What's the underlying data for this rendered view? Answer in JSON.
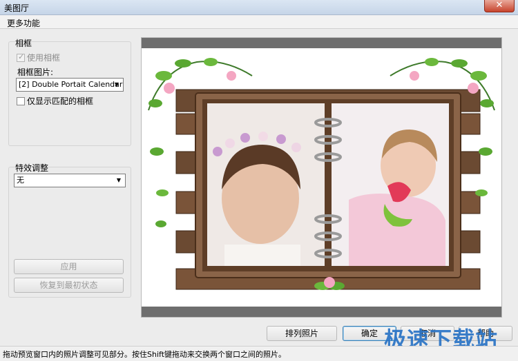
{
  "window": {
    "title": "美图厅",
    "close_symbol": "✕"
  },
  "menu": {
    "items": [
      "更多功能"
    ]
  },
  "frame_group": {
    "title": "相框",
    "use_frame_label": "使用相框",
    "frame_image_label": "相框图片:",
    "frame_image_value": "[2] Double Portait Calendar",
    "only_matching_label": "仅显示匹配的相框"
  },
  "effect_group": {
    "title": "特效调整",
    "effect_value": "无",
    "apply_label": "应用",
    "restore_label": "恢复到最初状态"
  },
  "buttons": {
    "arrange_label": "排列照片",
    "ok_label": "确定",
    "cancel_label": "取消",
    "help_label": "帮助"
  },
  "status": {
    "text": "拖动预览窗口内的照片调整可见部分。按住Shift键拖动来交换两个窗口之间的照片。"
  },
  "watermark": {
    "text": "极速下载站"
  },
  "colors": {
    "frame_wood": "#6b4a32",
    "watermark": "#2a74c6"
  }
}
